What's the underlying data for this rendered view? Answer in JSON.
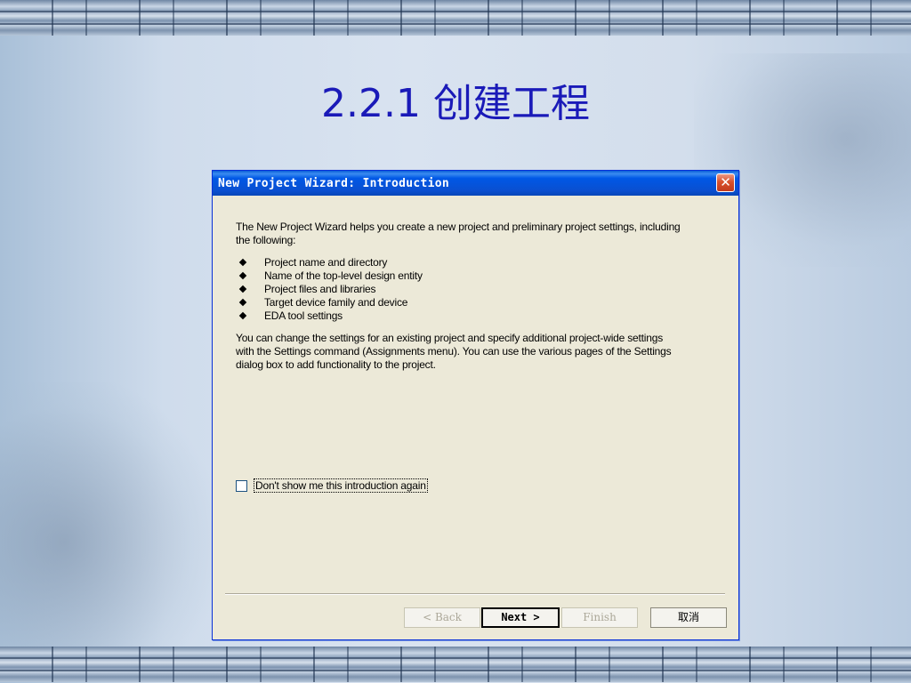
{
  "slide": {
    "title": "2.2.1 创建工程"
  },
  "dialog": {
    "title": "New Project Wizard: Introduction",
    "close_glyph": "✕",
    "intro": "The New Project Wizard helps you create a new project and preliminary project settings, including the following:",
    "bullets": [
      "Project name and directory",
      "Name of the top-level design entity",
      "Project files and libraries",
      "Target device family and device",
      "EDA tool settings"
    ],
    "description": "You can change the settings for an existing project and specify additional project-wide settings with the Settings command (Assignments menu). You can use the various pages of the Settings dialog box to add functionality to the project.",
    "checkbox_label": "Don't show me this introduction again",
    "checkbox_checked": false,
    "buttons": {
      "back": "< Back",
      "next": "Next >",
      "finish": "Finish",
      "cancel": "取消"
    }
  }
}
